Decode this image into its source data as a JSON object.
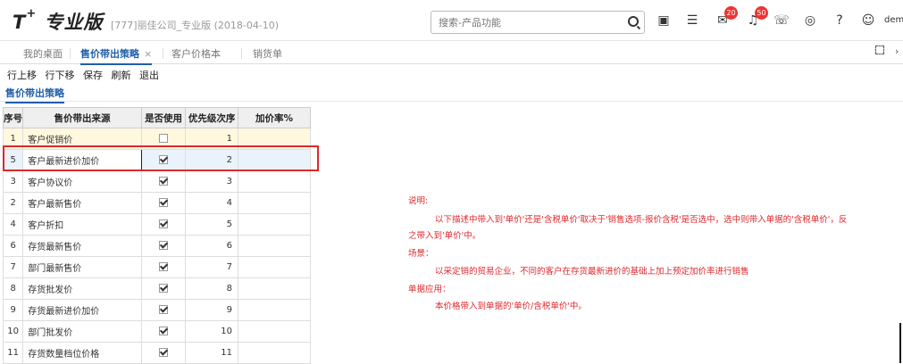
{
  "header": {
    "logo": "T",
    "logo_plus": "+",
    "product": "专业版",
    "company": "[777]丽佳公司_专业版 (2018-04-10)",
    "search_placeholder": "搜索-产品功能",
    "messages_badge": "20",
    "notifications_badge": "50",
    "user": "dem"
  },
  "tabs": [
    {
      "label": "我的桌面"
    },
    {
      "label": "售价带出策略",
      "close": "×"
    },
    {
      "label": "客户价格本"
    },
    {
      "label": "销货单"
    }
  ],
  "toolbar": {
    "move_up": "行上移",
    "move_down": "行下移",
    "save": "保存",
    "refresh": "刷新",
    "exit": "退出"
  },
  "section_title": "售价带出策略",
  "table": {
    "headers": [
      "序号",
      "售价带出来源",
      "是否使用",
      "优先级次序",
      "加价率%"
    ],
    "rows": [
      {
        "seq": "1",
        "source": "客户促销价",
        "used": false,
        "priority": "1"
      },
      {
        "seq": "5",
        "source": "客户最新进价加价",
        "used": true,
        "priority": "2"
      },
      {
        "seq": "3",
        "source": "客户协议价",
        "used": true,
        "priority": "3"
      },
      {
        "seq": "2",
        "source": "客户最新售价",
        "used": true,
        "priority": "4"
      },
      {
        "seq": "4",
        "source": "客户折扣",
        "used": true,
        "priority": "5"
      },
      {
        "seq": "6",
        "source": "存货最新售价",
        "used": true,
        "priority": "6"
      },
      {
        "seq": "7",
        "source": "部门最新售价",
        "used": true,
        "priority": "7"
      },
      {
        "seq": "8",
        "source": "存货批发价",
        "used": true,
        "priority": "8"
      },
      {
        "seq": "9",
        "source": "存货最新进价加价",
        "used": true,
        "priority": "9"
      },
      {
        "seq": "10",
        "source": "部门批发价",
        "used": true,
        "priority": "10"
      },
      {
        "seq": "11",
        "source": "存货数量档位价格",
        "used": true,
        "priority": "11"
      }
    ]
  },
  "notes": {
    "l1": "说明:",
    "l2": "以下描述中带入到'单价'还是'含税单价'取决于'销售选项-报价含税'是否选中，选中则带入单据的'含税单价'，反",
    "l3": "之带入到'单价'中。",
    "l4": "场景：",
    "l5": "以采定销的贸易企业，不同的客户在存货最新进价的基础上加上预定加价率进行销售",
    "l6": "单据应用：",
    "l7": "本价格带入到单据的'单价/含税单价'中。"
  },
  "colors": {
    "accent": "#1f5fa8",
    "highlight": "#e0282e"
  }
}
